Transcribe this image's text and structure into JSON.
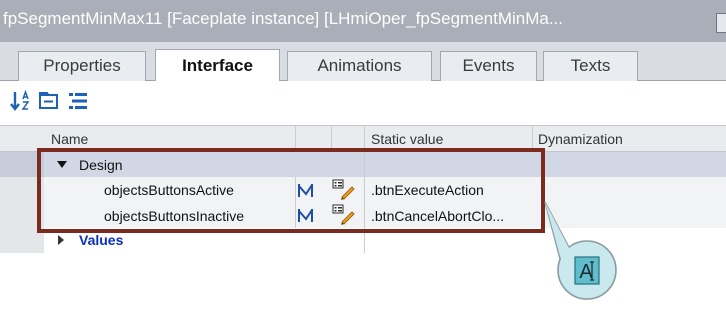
{
  "window": {
    "title": "fpSegmentMinMax11  [Faceplate  instance]  [LHmiOper_fpSegmentMinMa..."
  },
  "tabs": [
    {
      "label": "Properties",
      "active": false
    },
    {
      "label": "Interface",
      "active": true
    },
    {
      "label": "Animations",
      "active": false
    },
    {
      "label": "Events",
      "active": false
    },
    {
      "label": "Texts",
      "active": false
    }
  ],
  "toolbar": {
    "icons": [
      "sort-az-icon",
      "expand-all-icon",
      "collapse-all-icon"
    ]
  },
  "grid": {
    "columns": [
      "Name",
      "Static value",
      "Dynamization"
    ],
    "rows": [
      {
        "name": "Design",
        "expanded": true,
        "static_value": ""
      },
      {
        "name": "objectsButtonsActive",
        "static_value": ".btnExecuteAction"
      },
      {
        "name": "objectsButtonsInactive",
        "static_value": ".btnCancelAbortClo..."
      },
      {
        "name": "Values",
        "expanded": false,
        "static_value": ""
      }
    ]
  },
  "callout": {
    "label": "A"
  },
  "colors": {
    "accent_highlight": "#7a2a1e",
    "link_blue": "#0b2fbf",
    "selected_row": "#d2d7e6",
    "callout_fill": "#c9e9ee"
  }
}
